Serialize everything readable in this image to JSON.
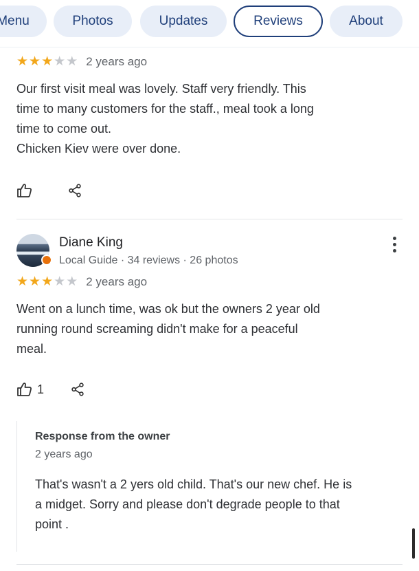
{
  "tabs": [
    {
      "label": "Menu"
    },
    {
      "label": "Photos"
    },
    {
      "label": "Updates"
    },
    {
      "label": "Reviews",
      "active": true
    },
    {
      "label": "About"
    }
  ],
  "reviews": [
    {
      "rating": 3,
      "time": "2 years ago",
      "text": [
        "Our first visit meal was lovely. Staff very friendly. This",
        "time to many customers for the staff., meal took a long",
        "time to come out.",
        "Chicken Kiev were over done."
      ],
      "likes": ""
    },
    {
      "author": "Diane King",
      "meta": "Local Guide · 34 reviews · 26 photos",
      "rating": 3,
      "time": "2 years ago",
      "text": [
        "Went on a lunch time, was ok but the owners 2 year old",
        "running round screaming didn't make for a peaceful",
        "meal."
      ],
      "likes": "1",
      "response": {
        "title": "Response from the owner",
        "time": "2 years ago",
        "text": [
          "That's wasn't a 2 yers old child. That's our new chef. He is",
          "a midget. Sorry and please don't degrade people to that",
          "point ."
        ]
      }
    }
  ],
  "colors": {
    "star_on": "#f2a71b",
    "star_off": "#c4c7cc",
    "tab_bg": "#e8eef8",
    "tab_text": "#1f3f7a",
    "guide_badge": "#e8710a"
  },
  "icons": [
    "thumbs-up-icon",
    "share-icon",
    "more-vert-icon",
    "local-guide-badge-icon"
  ]
}
